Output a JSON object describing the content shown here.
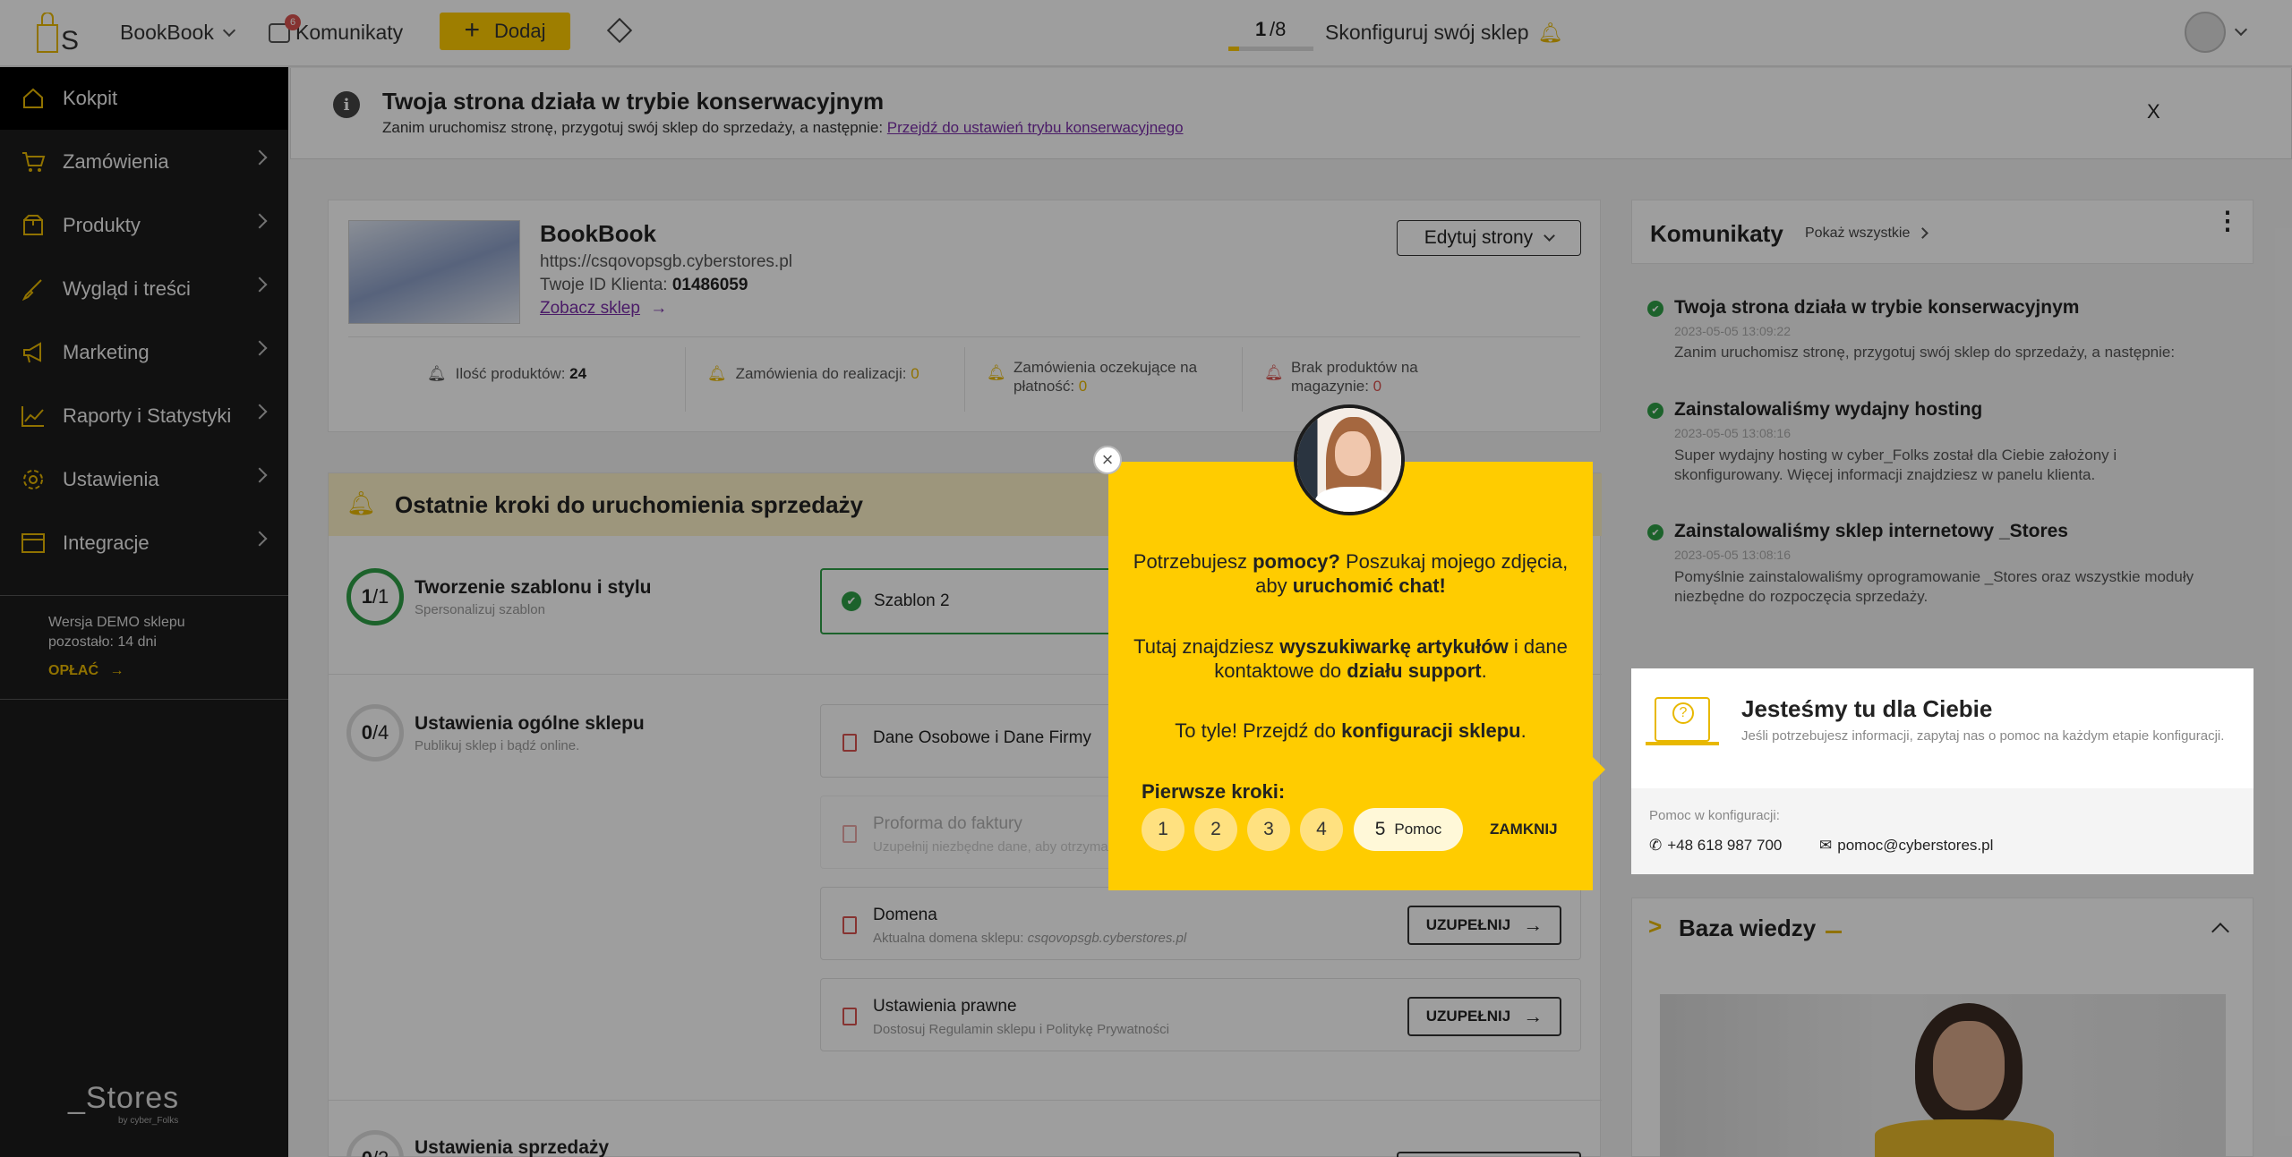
{
  "topbar": {
    "logo_letter": "S",
    "store_name": "BookBook",
    "messages_label": "Komunikaty",
    "messages_badge": "6",
    "add_label": "Dodaj",
    "progress_current": "1",
    "progress_total": "/8",
    "progress_fraction": 0.125,
    "configure_label": "Skonfiguruj swój sklep"
  },
  "sidebar": {
    "items": [
      {
        "label": "Kokpit",
        "icon": "home-icon"
      },
      {
        "label": "Zamówienia",
        "icon": "cart-icon"
      },
      {
        "label": "Produkty",
        "icon": "box-icon"
      },
      {
        "label": "Wygląd i treści",
        "icon": "brush-icon"
      },
      {
        "label": "Marketing",
        "icon": "megaphone-icon"
      },
      {
        "label": "Raporty i Statystyki",
        "icon": "chart-icon"
      },
      {
        "label": "Ustawienia",
        "icon": "gear-icon"
      },
      {
        "label": "Integracje",
        "icon": "integration-icon"
      }
    ],
    "demo_line1": "Wersja DEMO sklepu",
    "demo_line2": "pozostało: 14 dni",
    "pay_label": "OPŁAĆ",
    "brand": "_Stores",
    "brand_sub": "by cyber_Folks"
  },
  "banner": {
    "title": "Twoja strona działa w trybie konserwacyjnym",
    "text": "Zanim uruchomisz stronę, przygotuj swój sklep do sprzedaży, a następnie:",
    "link": "Przejdź do ustawień trybu konserwacyjnego",
    "close": "X"
  },
  "store": {
    "name": "BookBook",
    "url": "https://csqovopsgb.cyberstores.pl",
    "client_id_label": "Twoje ID Klienta:",
    "client_id": "01486059",
    "view_link": "Zobacz sklep",
    "edit_button": "Edytuj strony",
    "stats": [
      {
        "label": "Ilość produktów:",
        "value": "24"
      },
      {
        "label": "Zamówienia do realizacji:",
        "value": "0"
      },
      {
        "label": "Zamówienia oczekujące na płatność:",
        "value": "0"
      },
      {
        "label": "Brak produktów na magazynie:",
        "value": "0"
      }
    ]
  },
  "steps": {
    "title": "Ostatnie kroki do uruchomienia sprzedaży",
    "groups": [
      {
        "count": "1",
        "total": "/1",
        "title": "Tworzenie szablonu i stylu",
        "sub": "Spersonalizuj szablon"
      },
      {
        "count": "0",
        "total": "/4",
        "title": "Ustawienia ogólne sklepu",
        "sub": "Publikuj sklep i bądź online."
      },
      {
        "count": "0",
        "total": "/2",
        "title": "Ustawienia sprzedaży",
        "sub": ""
      }
    ],
    "template_item": "Szablon 2",
    "rows": [
      {
        "title": "Dane Osobowe i Dane Firmy",
        "sub": ""
      },
      {
        "title": "Proforma do faktury",
        "sub": "Uzupełnij niezbędne dane, aby otrzymać"
      },
      {
        "title": "Domena",
        "sub": "Aktualna domena sklepu:",
        "sub_em": "csqovopsgb.cyberstores.pl"
      },
      {
        "title": "Ustawienia prawne",
        "sub": "Dostosuj Regulamin sklepu i Politykę Prywatności"
      }
    ],
    "fill_button": "UZUPEŁNIJ"
  },
  "messages": {
    "title": "Komunikaty",
    "show_all": "Pokaż wszystkie",
    "items": [
      {
        "title": "Twoja strona działa w trybie konserwacyjnym",
        "date": "2023-05-05 13:09:22",
        "text": "Zanim uruchomisz stronę, przygotuj swój sklep do sprzedaży, a następnie:"
      },
      {
        "title": "Zainstalowaliśmy wydajny hosting",
        "date": "2023-05-05 13:08:16",
        "text": "Super wydajny hosting w cyber_Folks został dla Ciebie założony i skonfigurowany. Więcej informacji znajdziesz w panelu klienta."
      },
      {
        "title": "Zainstalowaliśmy sklep internetowy _Stores",
        "date": "2023-05-05 13:08:16",
        "text": "Pomyślnie zainstalowaliśmy oprogramowanie _Stores oraz wszystkie moduły niezbędne do rozpoczęcia sprzedaży."
      }
    ]
  },
  "help": {
    "title": "Jesteśmy tu dla Ciebie",
    "text": "Jeśli potrzebujesz informacji, zapytaj nas o pomoc na każdym etapie konfiguracji.",
    "config_label": "Pomoc w konfiguracji:",
    "phone": "+48 618 987 700",
    "email": "pomoc@cyberstores.pl"
  },
  "knowledge": {
    "title": "Baza wiedzy"
  },
  "popup": {
    "l1a": "Potrzebujesz ",
    "l1b": "pomocy?",
    "l1c": " Poszukaj mojego zdjęcia,",
    "l2a": "aby ",
    "l2b": "uruchomić chat!",
    "l3a": "Tutaj znajdziesz ",
    "l3b": "wyszukiwarkę artykułów",
    "l3c": " i dane",
    "l4a": "kontaktowe do ",
    "l4b": "działu support",
    "l4c": ".",
    "l5a": "To tyle! Przejdź do ",
    "l5b": "konfiguracji sklepu",
    "l5c": ".",
    "first_steps": "Pierwsze kroki:",
    "steps": [
      "1",
      "2",
      "3",
      "4"
    ],
    "active_step": "5",
    "active_label": "Pomoc",
    "close_label": "ZAMKNIJ",
    "close_x": "×"
  },
  "colors": {
    "accent": "#ffcc00",
    "sidebar": "#1c1c1c",
    "success": "#2e9e46",
    "alert": "#d9534f"
  }
}
